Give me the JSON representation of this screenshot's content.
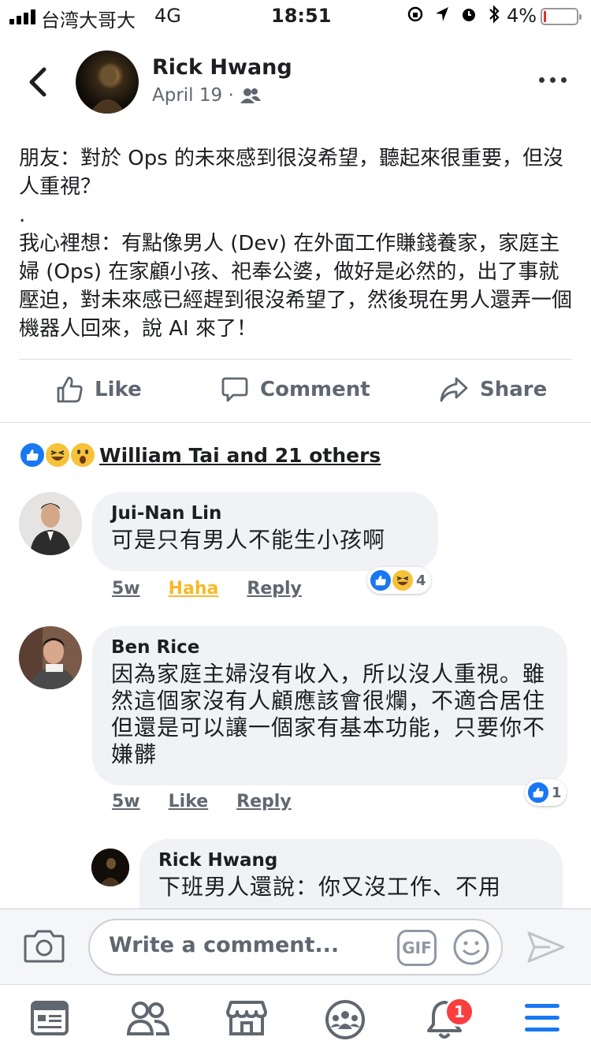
{
  "status": {
    "carrier": "台湾大哥大",
    "network": "4G",
    "time": "18:51",
    "battery": "4%"
  },
  "post": {
    "author": "Rick Hwang",
    "date": "April 19 ·",
    "text": "朋友：對於 Ops 的未來感到很沒希望，聽起來很重要，但沒人重視？\n.\n我心裡想：有點像男人 (Dev) 在外面工作賺錢養家，家庭主婦 (Ops) 在家顧小孩、祀奉公婆，做好是必然的，出了事就壓迫，對未來感已經趕到很沒希望了，然後現在男人還弄一個機器人回來，說 AI 來了！"
  },
  "actions": {
    "like": "Like",
    "comment": "Comment",
    "share": "Share"
  },
  "reactions": {
    "names": "William Tai and 21 others"
  },
  "comments": [
    {
      "name": "Jui-Nan Lin",
      "text": "可是只有男人不能生小孩啊",
      "time": "5w",
      "action1": "Haha",
      "reply": "Reply",
      "reaction_count": "4"
    },
    {
      "name": "Ben Rice",
      "text": "因為家庭主婦沒有收入，所以沒人重視。雖然這個家沒有人顧應該會很爛，不適合居住但還是可以讓一個家有基本功能，只要你不嫌髒",
      "time": "5w",
      "action1": "Like",
      "reply": "Reply",
      "reaction_count": "1"
    },
    {
      "name": "Rick Hwang",
      "text": "下班男人還說：你又沒工作、不用"
    }
  ],
  "composer": {
    "placeholder": "Write a comment...",
    "gif": "GIF"
  },
  "tabbar": {
    "notification_count": "1"
  },
  "colors": {
    "accent": "#1877f2",
    "haha": "#f7b928",
    "badge": "#fa3e3e"
  }
}
